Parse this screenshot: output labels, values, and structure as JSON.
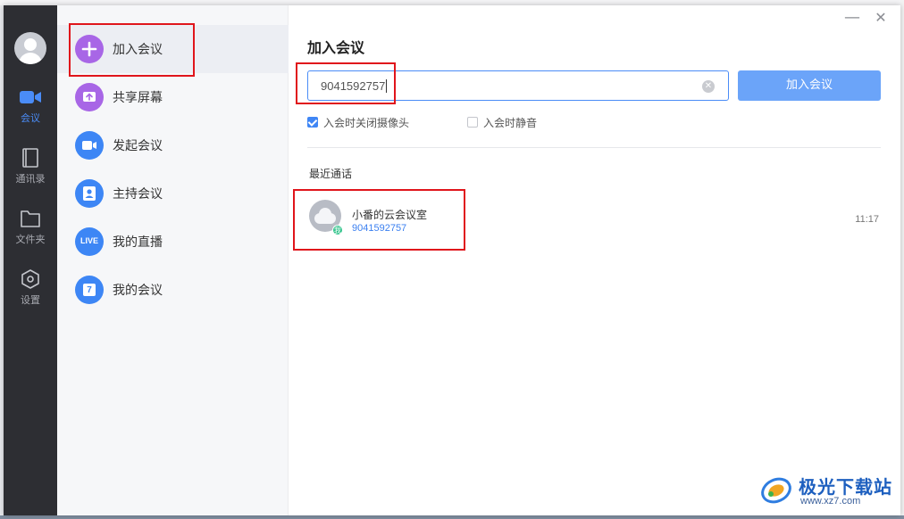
{
  "rail": {
    "items": [
      {
        "label": "会议",
        "icon": "video-camera-icon"
      },
      {
        "label": "通讯录",
        "icon": "contacts-book-icon"
      },
      {
        "label": "文件夹",
        "icon": "folder-icon"
      },
      {
        "label": "设置",
        "icon": "settings-hexagon-icon"
      }
    ],
    "active_index": 0,
    "accent": "#4a8cf7"
  },
  "menu": {
    "items": [
      {
        "label": "加入会议",
        "icon": "plus-icon",
        "color": "#a866e6"
      },
      {
        "label": "共享屏幕",
        "icon": "share-screen-icon",
        "color": "#a866e6"
      },
      {
        "label": "发起会议",
        "icon": "video-icon",
        "color": "#3d86f5"
      },
      {
        "label": "主持会议",
        "icon": "host-icon",
        "color": "#3d86f5"
      },
      {
        "label": "我的直播",
        "icon": "live-icon",
        "text": "LIVE",
        "color": "#3d86f5"
      },
      {
        "label": "我的会议",
        "icon": "calendar-icon",
        "text": "7",
        "color": "#3d86f5"
      }
    ],
    "active_index": 0
  },
  "main": {
    "title": "加入会议",
    "meeting_id_value": "9041592757",
    "join_button_label": "加入会议",
    "options": [
      {
        "label": "入会时关闭摄像头",
        "checked": true
      },
      {
        "label": "入会时静音",
        "checked": false
      }
    ],
    "recent_title": "最近通话",
    "recent": [
      {
        "name": "小番的云会议室",
        "id": "9041592757",
        "time": "11:17",
        "badge": "我"
      }
    ]
  },
  "window_controls": {
    "minimize": "—",
    "close": "✕"
  },
  "watermark": {
    "name": "极光下载站",
    "url": "www.xz7.com"
  },
  "colors": {
    "primary": "#4a8cf7",
    "highlight": "#e0151b",
    "rail_bg": "#2d2e33"
  }
}
